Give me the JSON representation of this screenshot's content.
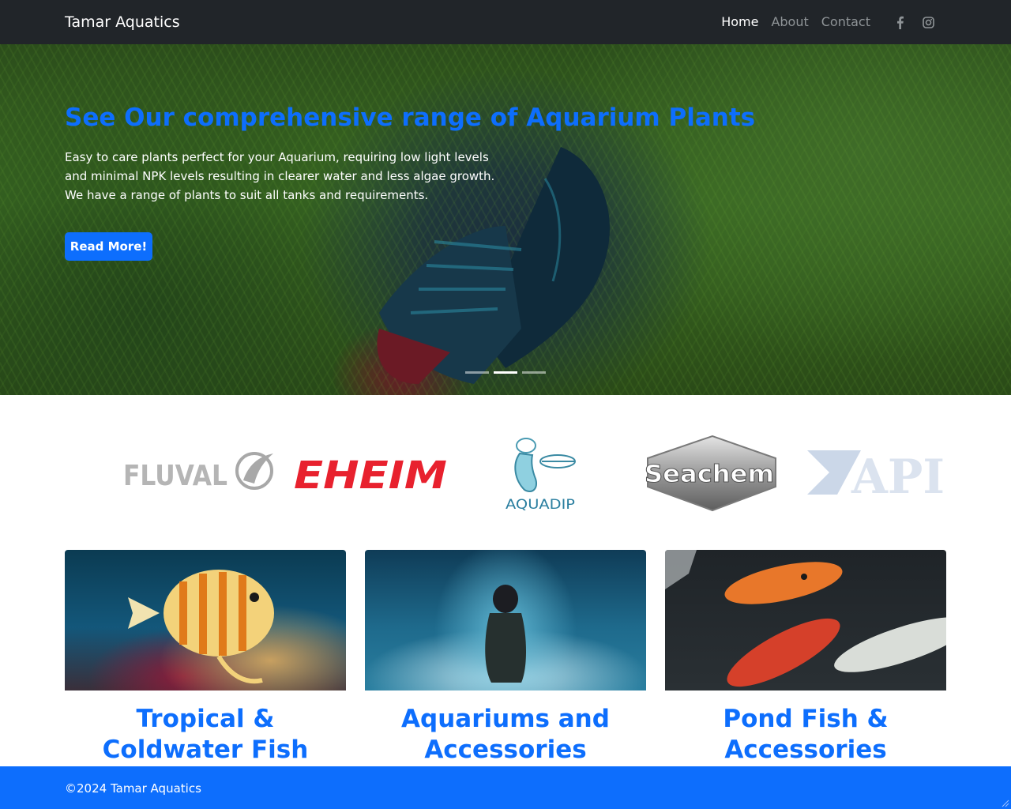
{
  "navbar": {
    "brand": "Tamar Aquatics",
    "links": [
      {
        "label": "Home",
        "active": true
      },
      {
        "label": "About",
        "active": false
      },
      {
        "label": "Contact",
        "active": false
      }
    ],
    "social": [
      {
        "icon": "facebook-icon"
      },
      {
        "icon": "instagram-icon"
      }
    ]
  },
  "hero": {
    "title": "See Our comprehensive range of Aquarium Plants",
    "text": "Easy to care plants perfect for your Aquarium, requiring low light levels and minimal NPK levels resulting in clearer water and less algae growth. We have a range of plants to suit all tanks and requirements.",
    "button_label": "Read More!",
    "slide_count": 3,
    "active_slide": 2
  },
  "brands": {
    "fluval": "FLUVAL",
    "eheim": "EHEIM",
    "aquadip": "AQUADIP",
    "seachem": "Seachem",
    "api": "API"
  },
  "cards": [
    {
      "title": "Tropical & Coldwater Fish"
    },
    {
      "title": "Aquariums and Accessories"
    },
    {
      "title": "Pond Fish & Accessories"
    }
  ],
  "footer": {
    "text": "©2024 Tamar Aquatics"
  },
  "colors": {
    "navbar_bg": "#212529",
    "accent": "#0d6efd",
    "footer_bg": "#0d6efd"
  }
}
